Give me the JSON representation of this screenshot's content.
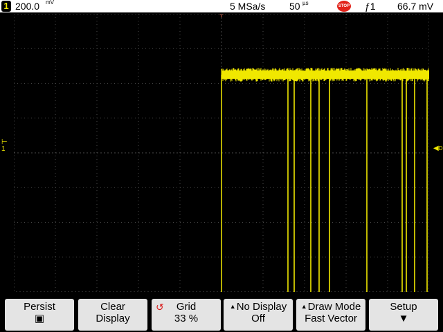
{
  "status": {
    "channel_number": "1",
    "channel_scale": "200.0",
    "channel_unit": "mV",
    "trigger_marker": "T",
    "sample_rate": "5 MSa/s",
    "timebase": "50",
    "timebase_unit": "µs",
    "run_state": "STOP",
    "trigger_source": "1",
    "trigger_level": "66.7 mV"
  },
  "markers": {
    "channel1": "1",
    "trigger_level": "DC"
  },
  "waveform": {
    "color": "#f0e800",
    "grid_color": "#4a4a4a",
    "low_level_div": 4.95,
    "high_level_div": -2.25,
    "step_time_div": 5.0,
    "glitch_times_div": [
      6.6,
      6.75,
      7.15,
      7.35,
      7.6,
      8.5,
      9.35,
      9.45,
      9.65,
      9.95
    ]
  },
  "softkeys": [
    {
      "line1": "Persist",
      "line2": "▣"
    },
    {
      "line1": "Clear",
      "line2": "Display"
    },
    {
      "line1": "Grid",
      "line2": "33 %"
    },
    {
      "line1": "No Display",
      "line2": "Off"
    },
    {
      "line1": "Draw Mode",
      "line2": "Fast Vector"
    },
    {
      "line1": "Setup",
      "line2": "▼"
    }
  ]
}
